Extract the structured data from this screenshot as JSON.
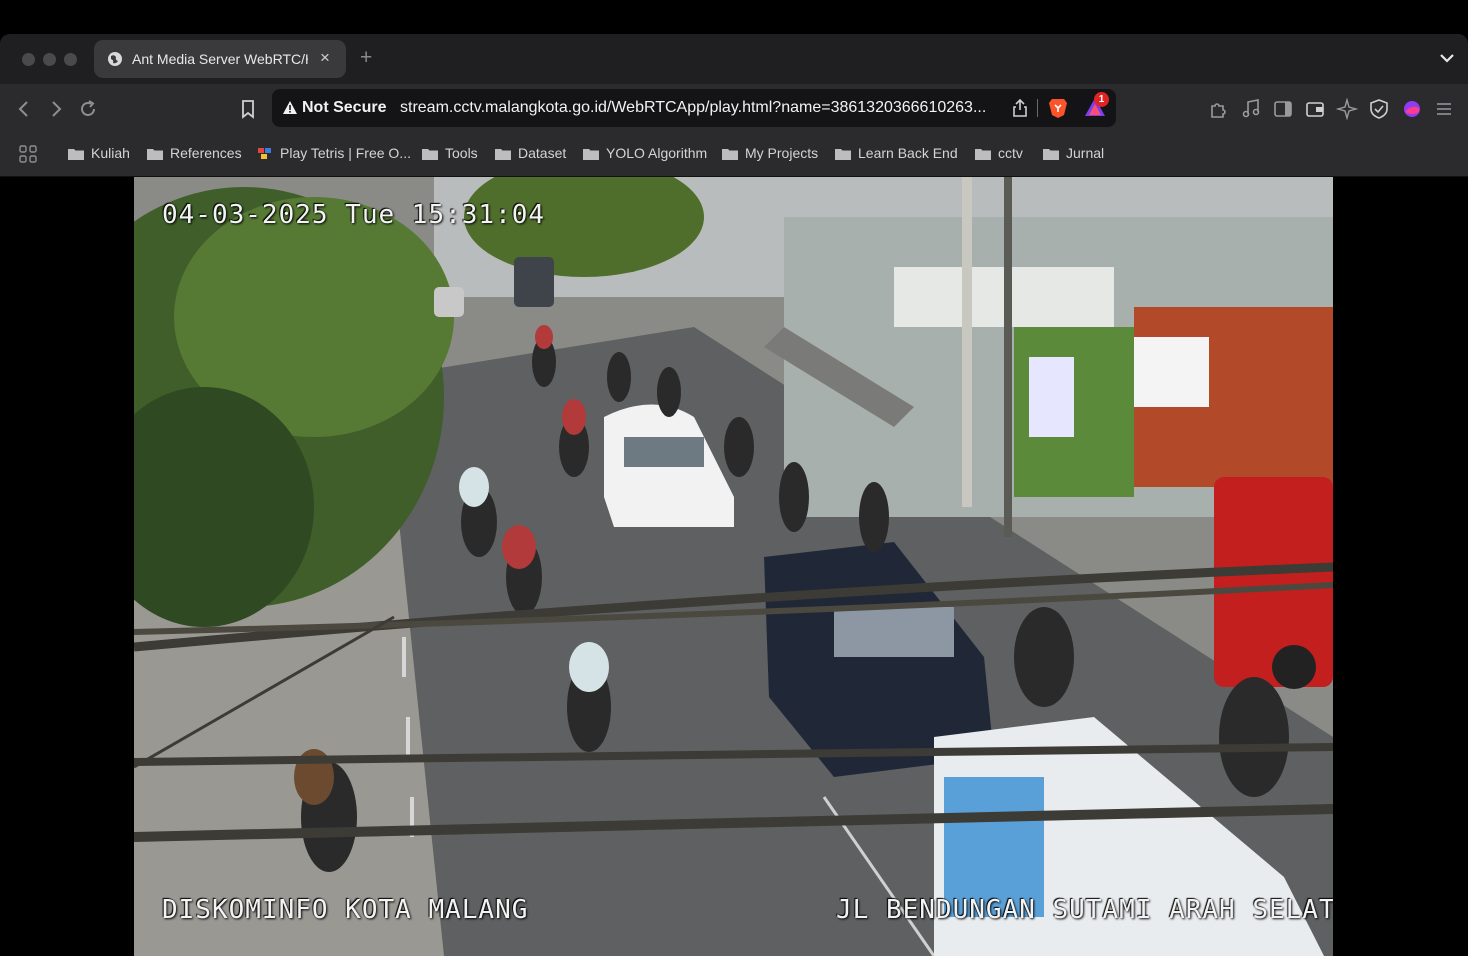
{
  "browser": {
    "tab": {
      "title": "Ant Media Server WebRTC/HLS"
    },
    "address_bar": {
      "security_label": "Not Secure",
      "url": "stream.cctv.malangkota.go.id/WebRTCApp/play.html?name=3861320366610263...",
      "rewards_badge": "1"
    },
    "bookmarks": [
      {
        "label": "Kuliah",
        "icon": "folder-icon"
      },
      {
        "label": "References",
        "icon": "folder-icon"
      },
      {
        "label": "Play Tetris | Free O...",
        "icon": "tetris-favicon"
      },
      {
        "label": "Tools",
        "icon": "folder-icon"
      },
      {
        "label": "Dataset",
        "icon": "folder-icon"
      },
      {
        "label": "YOLO Algorithm",
        "icon": "folder-icon"
      },
      {
        "label": "My Projects",
        "icon": "folder-icon"
      },
      {
        "label": "Learn Back End",
        "icon": "folder-icon"
      },
      {
        "label": "cctv",
        "icon": "folder-icon"
      },
      {
        "label": "Jurnal",
        "icon": "folder-icon"
      }
    ]
  },
  "video": {
    "timestamp": "04-03-2025 Tue 15:31:04",
    "source_label": "DISKOMINFO KOTA MALANG",
    "location_label": "JL BENDUNGAN SUTAMI ARAH SELATAN"
  },
  "colors": {
    "window_bg": "#1a1a1c",
    "toolbar_bg": "#2b2b2e",
    "urlbar_bg": "#141416",
    "badge": "#e02424",
    "brave_orange": "#fb542b"
  }
}
